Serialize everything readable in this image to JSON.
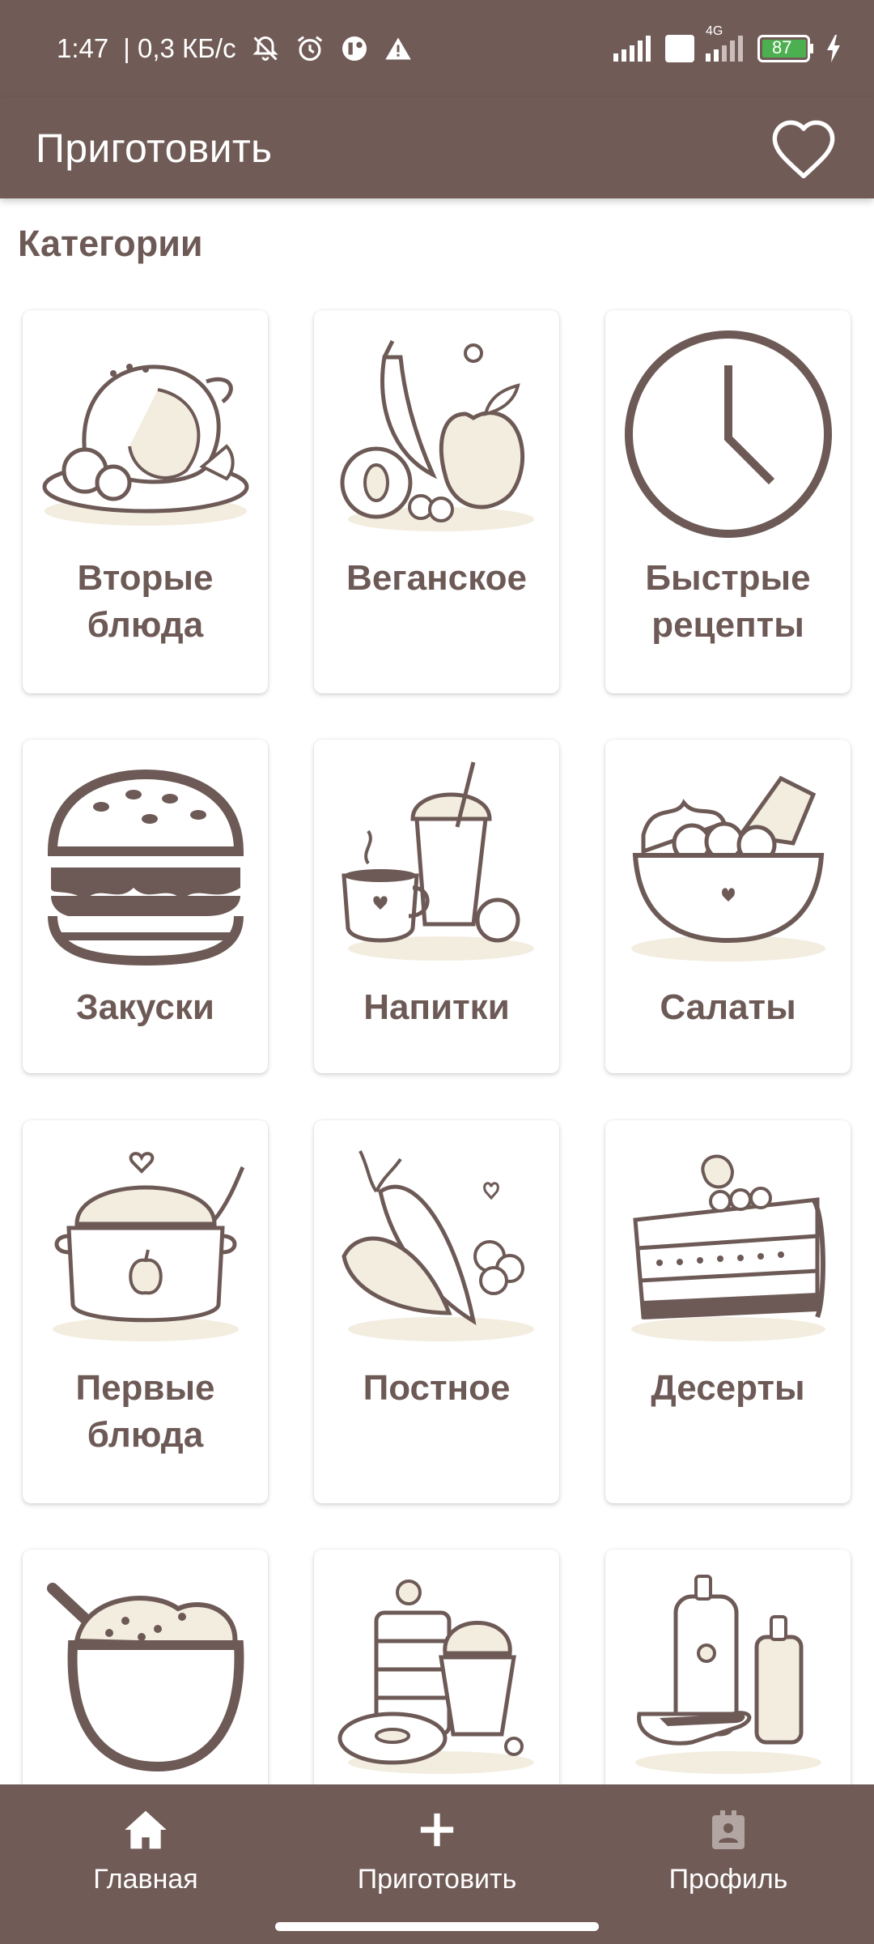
{
  "status_bar": {
    "time": "1:47",
    "speed": "| 0,3 КБ/с",
    "network": "4G",
    "volte": "Vo LTE",
    "battery": "87"
  },
  "app_bar": {
    "title": "Приготовить",
    "favorite_icon": "heart-outline-icon"
  },
  "section": {
    "title": "Категории"
  },
  "categories": [
    {
      "label": "Вторые блюда",
      "icon": "roast-chicken-illustration"
    },
    {
      "label": "Веганское",
      "icon": "fruits-illustration"
    },
    {
      "label": "Быстрые рецепты",
      "icon": "clock-illustration"
    },
    {
      "label": "Закуски",
      "icon": "burger-illustration"
    },
    {
      "label": "Напитки",
      "icon": "drinks-illustration"
    },
    {
      "label": "Салаты",
      "icon": "salad-bowl-illustration"
    },
    {
      "label": "Первые блюда",
      "icon": "soup-pot-illustration"
    },
    {
      "label": "Постное",
      "icon": "vegetables-illustration"
    },
    {
      "label": "Десерты",
      "icon": "cake-illustration"
    },
    {
      "label": "",
      "icon": "porridge-bowl-illustration"
    },
    {
      "label": "",
      "icon": "pastry-illustration"
    },
    {
      "label": "",
      "icon": "sauces-illustration"
    }
  ],
  "bottom_nav": [
    {
      "label": "Главная",
      "icon": "home-icon"
    },
    {
      "label": "Приготовить",
      "icon": "plus-icon"
    },
    {
      "label": "Профиль",
      "icon": "profile-icon"
    }
  ],
  "colors": {
    "primary": "#705b56",
    "text": "#6d5a56",
    "illustration_fill": "#f3ede0",
    "battery_green": "#4caf50"
  }
}
